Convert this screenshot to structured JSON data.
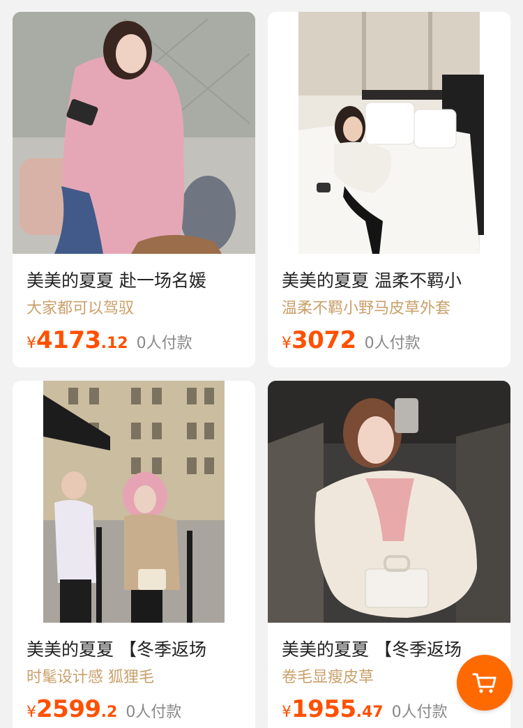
{
  "products": [
    {
      "title": "美美的夏夏 赴一场名媛",
      "subtitle": "大家都可以驾驭",
      "currency": "¥",
      "price_int": "4173",
      "price_dec": ".12",
      "sales": "0人付款",
      "image_desc": "pink-fur-coat-photo"
    },
    {
      "title": "美美的夏夏 温柔不羁小",
      "subtitle": "温柔不羁小野马皮草外套",
      "currency": "¥",
      "price_int": "3072",
      "price_dec": "",
      "sales": "0人付款",
      "image_desc": "white-fur-coat-bed-photo"
    },
    {
      "title": "美美的夏夏 【冬季返场",
      "subtitle": "时髦设计感 狐狸毛",
      "currency": "¥",
      "price_int": "2599",
      "price_dec": ".2",
      "sales": "0人付款",
      "image_desc": "pink-hood-parka-street-photo"
    },
    {
      "title": "美美的夏夏 【冬季返场",
      "subtitle": "卷毛显瘦皮草",
      "currency": "¥",
      "price_int": "1955",
      "price_dec": ".47",
      "sales": "0人付款",
      "image_desc": "cream-fur-jacket-elevator-photo"
    }
  ],
  "cart_button": {
    "icon": "cart-icon"
  },
  "colors": {
    "price": "#ff5000",
    "subtitle": "#c9a06a",
    "fab": "#ff6a00",
    "background": "#f2f2f2"
  }
}
